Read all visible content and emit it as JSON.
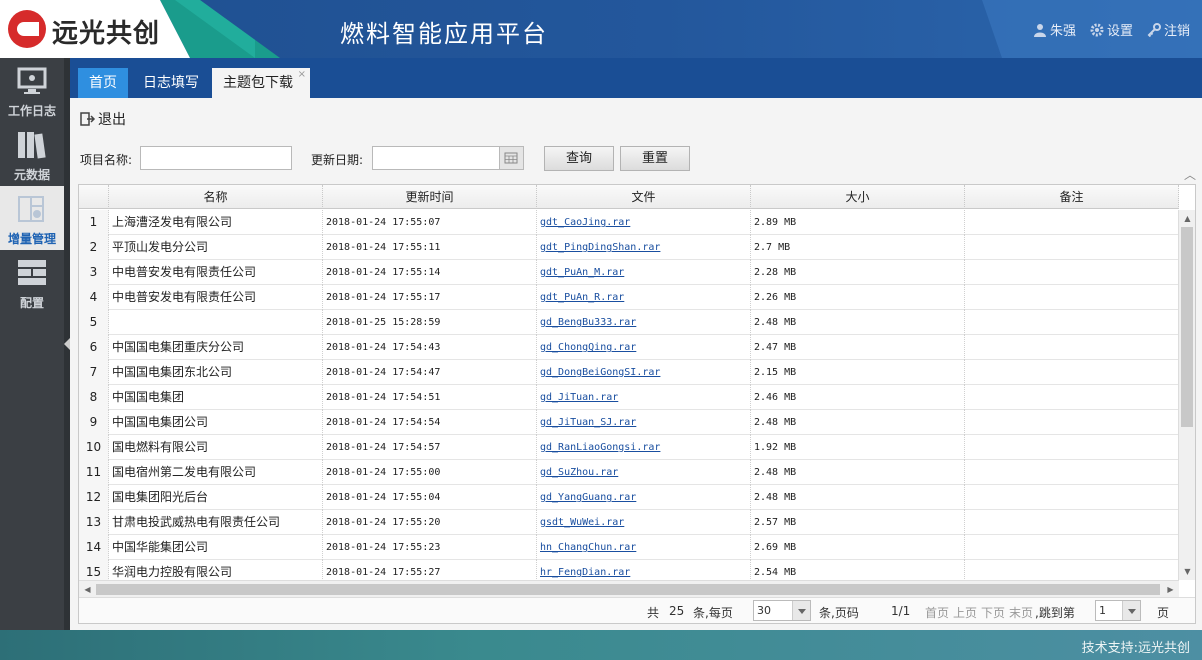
{
  "brand": {
    "logo_text": "远光共创",
    "app_title": "燃料智能应用平台"
  },
  "user_tools": {
    "user": "朱强",
    "settings": "设置",
    "logout": "注销"
  },
  "sidebar": {
    "items": [
      {
        "label": "工作日志"
      },
      {
        "label": "元数据"
      },
      {
        "label": "增量管理"
      },
      {
        "label": "配置"
      }
    ]
  },
  "tabs": {
    "home": "首页",
    "log": "日志填写",
    "download": "主题包下载",
    "close": "×"
  },
  "toolbar": {
    "exit_label": "退出"
  },
  "filters": {
    "project_label": "项目名称:",
    "project_value": "",
    "date_label": "更新日期:",
    "date_value": "",
    "query_label": "查询",
    "reset_label": "重置"
  },
  "table": {
    "columns": [
      "名称",
      "更新时间",
      "文件",
      "大小",
      "备注"
    ],
    "rows": [
      {
        "no": "1",
        "name": "上海漕泾发电有限公司",
        "time": "2018-01-24 17:55:07",
        "file": "gdt_CaoJing.rar",
        "size": "2.89 MB",
        "note": ""
      },
      {
        "no": "2",
        "name": "平顶山发电分公司",
        "time": "2018-01-24 17:55:11",
        "file": "gdt_PingDingShan.rar",
        "size": "2.7 MB",
        "note": ""
      },
      {
        "no": "3",
        "name": "中电普安发电有限责任公司",
        "time": "2018-01-24 17:55:14",
        "file": "gdt_PuAn_M.rar",
        "size": "2.28 MB",
        "note": ""
      },
      {
        "no": "4",
        "name": "中电普安发电有限责任公司",
        "time": "2018-01-24 17:55:17",
        "file": "gdt_PuAn_R.rar",
        "size": "2.26 MB",
        "note": ""
      },
      {
        "no": "5",
        "name": "",
        "time": "2018-01-25 15:28:59",
        "file": "gd_BengBu333.rar",
        "size": "2.48 MB",
        "note": ""
      },
      {
        "no": "6",
        "name": "中国国电集团重庆分公司",
        "time": "2018-01-24 17:54:43",
        "file": "gd_ChongQing.rar",
        "size": "2.47 MB",
        "note": ""
      },
      {
        "no": "7",
        "name": "中国国电集团东北公司",
        "time": "2018-01-24 17:54:47",
        "file": "gd_DongBeiGongSI.rar",
        "size": "2.15 MB",
        "note": ""
      },
      {
        "no": "8",
        "name": "中国国电集团",
        "time": "2018-01-24 17:54:51",
        "file": "gd_JiTuan.rar",
        "size": "2.46 MB",
        "note": ""
      },
      {
        "no": "9",
        "name": "中国国电集团公司",
        "time": "2018-01-24 17:54:54",
        "file": "gd_JiTuan_SJ.rar",
        "size": "2.48 MB",
        "note": ""
      },
      {
        "no": "10",
        "name": "国电燃料有限公司",
        "time": "2018-01-24 17:54:57",
        "file": "gd_RanLiaoGongsi.rar",
        "size": "1.92 MB",
        "note": ""
      },
      {
        "no": "11",
        "name": "国电宿州第二发电有限公司",
        "time": "2018-01-24 17:55:00",
        "file": "gd_SuZhou.rar",
        "size": "2.48 MB",
        "note": ""
      },
      {
        "no": "12",
        "name": "国电集团阳光后台",
        "time": "2018-01-24 17:55:04",
        "file": "gd_YangGuang.rar",
        "size": "2.48 MB",
        "note": ""
      },
      {
        "no": "13",
        "name": "甘肃电投武威热电有限责任公司",
        "time": "2018-01-24 17:55:20",
        "file": "gsdt_WuWei.rar",
        "size": "2.57 MB",
        "note": ""
      },
      {
        "no": "14",
        "name": "中国华能集团公司",
        "time": "2018-01-24 17:55:23",
        "file": "hn_ChangChun.rar",
        "size": "2.69 MB",
        "note": ""
      },
      {
        "no": "15",
        "name": "华润电力控股有限公司",
        "time": "2018-01-24 17:55:27",
        "file": "hr_FengDian.rar",
        "size": "2.54 MB",
        "note": ""
      }
    ]
  },
  "pager": {
    "total_prefix": "共",
    "total": "25",
    "per_page_prefix": "条,每页",
    "per_page": "30",
    "page_label": "条,页码",
    "page_info": "1/1",
    "first": "首页",
    "prev": "上页",
    "next": "下页",
    "last": "末页",
    "jump_label": ",跳到第",
    "jump_value": "1",
    "page_suffix": "页"
  },
  "footer": {
    "support": "技术支持:远光共创"
  },
  "colors": {
    "header": "#23579c",
    "sidebar": "#3b3f44",
    "active_tab": "#2f8fe0",
    "link": "#1a4fa0",
    "footer": "#3a8a8e"
  }
}
